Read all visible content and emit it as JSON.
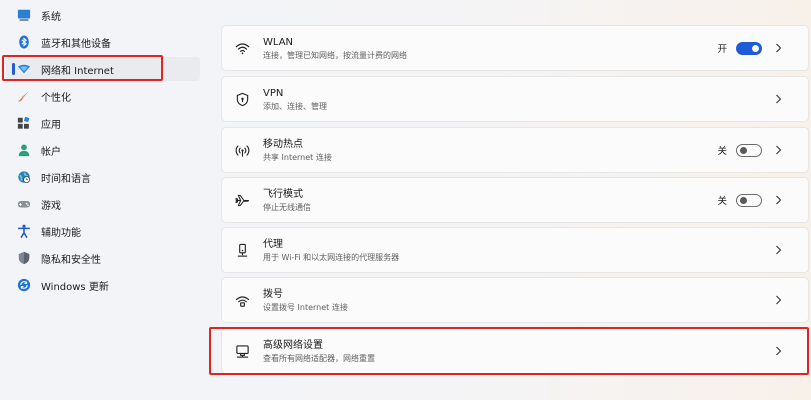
{
  "sidebar": {
    "items": [
      {
        "label": "系统",
        "icon": "monitor-icon"
      },
      {
        "label": "蓝牙和其他设备",
        "icon": "bluetooth-icon"
      },
      {
        "label": "网络和 Internet",
        "icon": "wifi-diamond-icon",
        "active": true
      },
      {
        "label": "个性化",
        "icon": "brush-icon"
      },
      {
        "label": "应用",
        "icon": "apps-icon"
      },
      {
        "label": "帐户",
        "icon": "person-icon"
      },
      {
        "label": "时间和语言",
        "icon": "globe-clock-icon"
      },
      {
        "label": "游戏",
        "icon": "gamepad-icon"
      },
      {
        "label": "辅助功能",
        "icon": "accessibility-icon"
      },
      {
        "label": "隐私和安全性",
        "icon": "shield-icon"
      },
      {
        "label": "Windows 更新",
        "icon": "sync-icon"
      }
    ]
  },
  "settings": {
    "cards": [
      {
        "title": "WLAN",
        "subtitle": "连接，管理已知网络，按流量计费的网络",
        "icon": "wifi-icon",
        "state": "开",
        "toggle": "on"
      },
      {
        "title": "VPN",
        "subtitle": "添加、连接、管理",
        "icon": "vpn-shield-icon"
      },
      {
        "title": "移动热点",
        "subtitle": "共享 Internet 连接",
        "icon": "hotspot-icon",
        "state": "关",
        "toggle": "off"
      },
      {
        "title": "飞行模式",
        "subtitle": "停止无线通信",
        "icon": "airplane-icon",
        "state": "关",
        "toggle": "off"
      },
      {
        "title": "代理",
        "subtitle": "用于 Wi-Fi 和以太网连接的代理服务器",
        "icon": "proxy-icon"
      },
      {
        "title": "拨号",
        "subtitle": "设置拨号 Internet 连接",
        "icon": "dialup-icon"
      },
      {
        "title": "高级网络设置",
        "subtitle": "查看所有网络适配器，网络重置",
        "icon": "network-pc-icon"
      }
    ]
  },
  "colors": {
    "accent": "#1e5bd6",
    "highlight": "#e02424"
  }
}
